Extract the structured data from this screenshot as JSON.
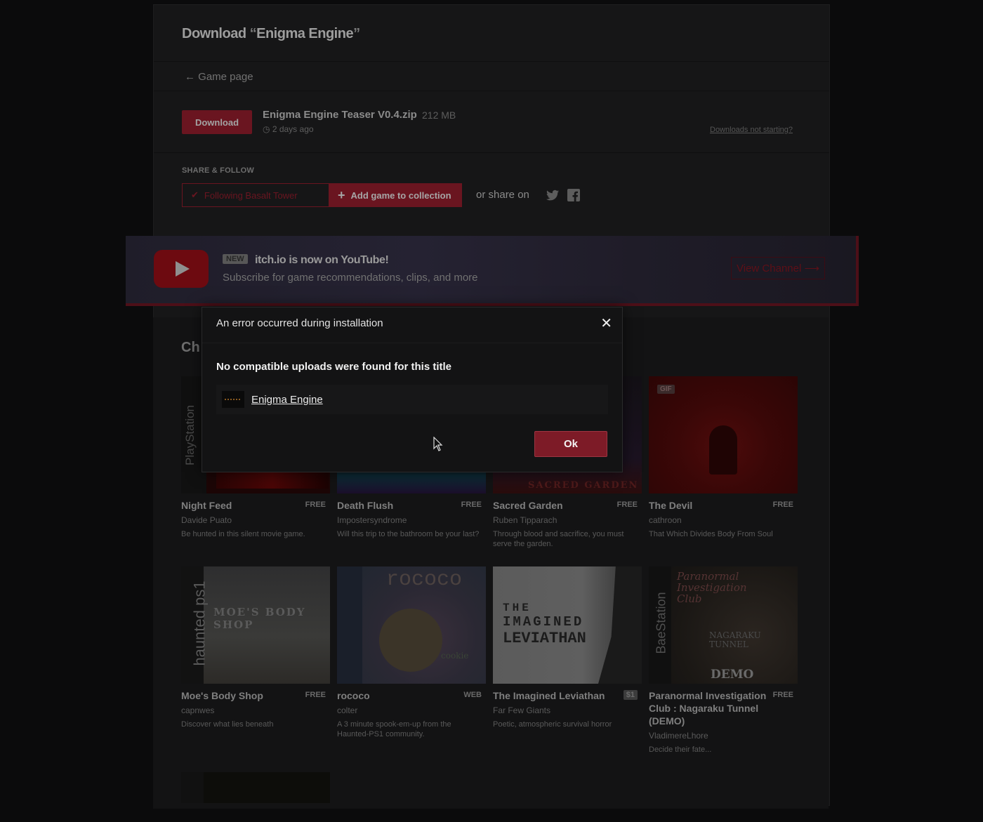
{
  "header": {
    "title_prefix": "Download ",
    "quote_open": "“",
    "game_title": "Enigma Engine",
    "quote_close": "”",
    "back_link": "← Game page"
  },
  "download": {
    "button_label": "Download",
    "file_name": "Enigma Engine Teaser V0.4.zip",
    "file_size": "212 MB",
    "uploaded": "2 days ago",
    "not_starting": "Downloads not starting?"
  },
  "share": {
    "heading": "SHARE & FOLLOW",
    "follow_label": "Following Basalt Tower",
    "add_label": "Add game to collection",
    "share_on": "or share on",
    "icons": [
      "twitter-icon",
      "facebook-icon"
    ]
  },
  "banner": {
    "new_tag": "NEW",
    "headline": "itch.io is now on YouTube!",
    "subline": "Subscribe for game recommendations, clips, and more",
    "cta": "View Channel ⟶"
  },
  "section": {
    "heading_partial": "Ch"
  },
  "games": [
    {
      "name": "Night Feed",
      "price": "FREE",
      "author": "Davide Puato",
      "desc": "Be hunted in this silent movie game."
    },
    {
      "name": "Death Flush",
      "price": "FREE",
      "author": "Impostersyndrome",
      "desc": "Will this trip to the bathroom be your last?"
    },
    {
      "name": "Sacred Garden",
      "price": "FREE",
      "author": "Ruben Tipparach",
      "desc": "Through blood and sacrifice, you must serve the garden."
    },
    {
      "name": "The Devil",
      "price": "FREE",
      "author": "cathroon",
      "desc": "That Which Divides Body From Soul"
    },
    {
      "name": "Moe's Body Shop",
      "price": "FREE",
      "author": "capnwes",
      "desc": "Discover what lies beneath"
    },
    {
      "name": "rococo",
      "price": "WEB",
      "author": "colter",
      "desc": "A 3 minute spook-em-up from the Haunted-PS1 community."
    },
    {
      "name": "The Imagined Leviathan",
      "price": "$1",
      "author": "Far Few Giants",
      "desc": "Poetic, atmospheric survival horror"
    },
    {
      "name": "Paranormal Investigation Club : Nagaraku Tunnel (DEMO)",
      "price": "FREE",
      "author": "VladimereLhore",
      "desc": "Decide their fate..."
    }
  ],
  "thumb_text": {
    "gif": "GIF",
    "playstation": "PlayStation",
    "sacred": "SACRED GARDEN",
    "haunted": "haunted ps1",
    "moes": "MOE'S BODY SHOP",
    "rococo": "rococo",
    "cookie": "cookie",
    "leviathan_1": "THE",
    "leviathan_2": "IMAGINED",
    "leviathan_3": "LEVIATHAN",
    "baestation": "BaeStation",
    "paranormal": "Paranormal Investigation Club",
    "nagaraku": "NAGARAKU TUNNEL",
    "demo": "DEMO"
  },
  "modal": {
    "title": "An error occurred during installation",
    "close_glyph": "✕",
    "message": "No compatible uploads were found for this title",
    "game_link": "Enigma Engine",
    "ok_label": "Ok"
  }
}
